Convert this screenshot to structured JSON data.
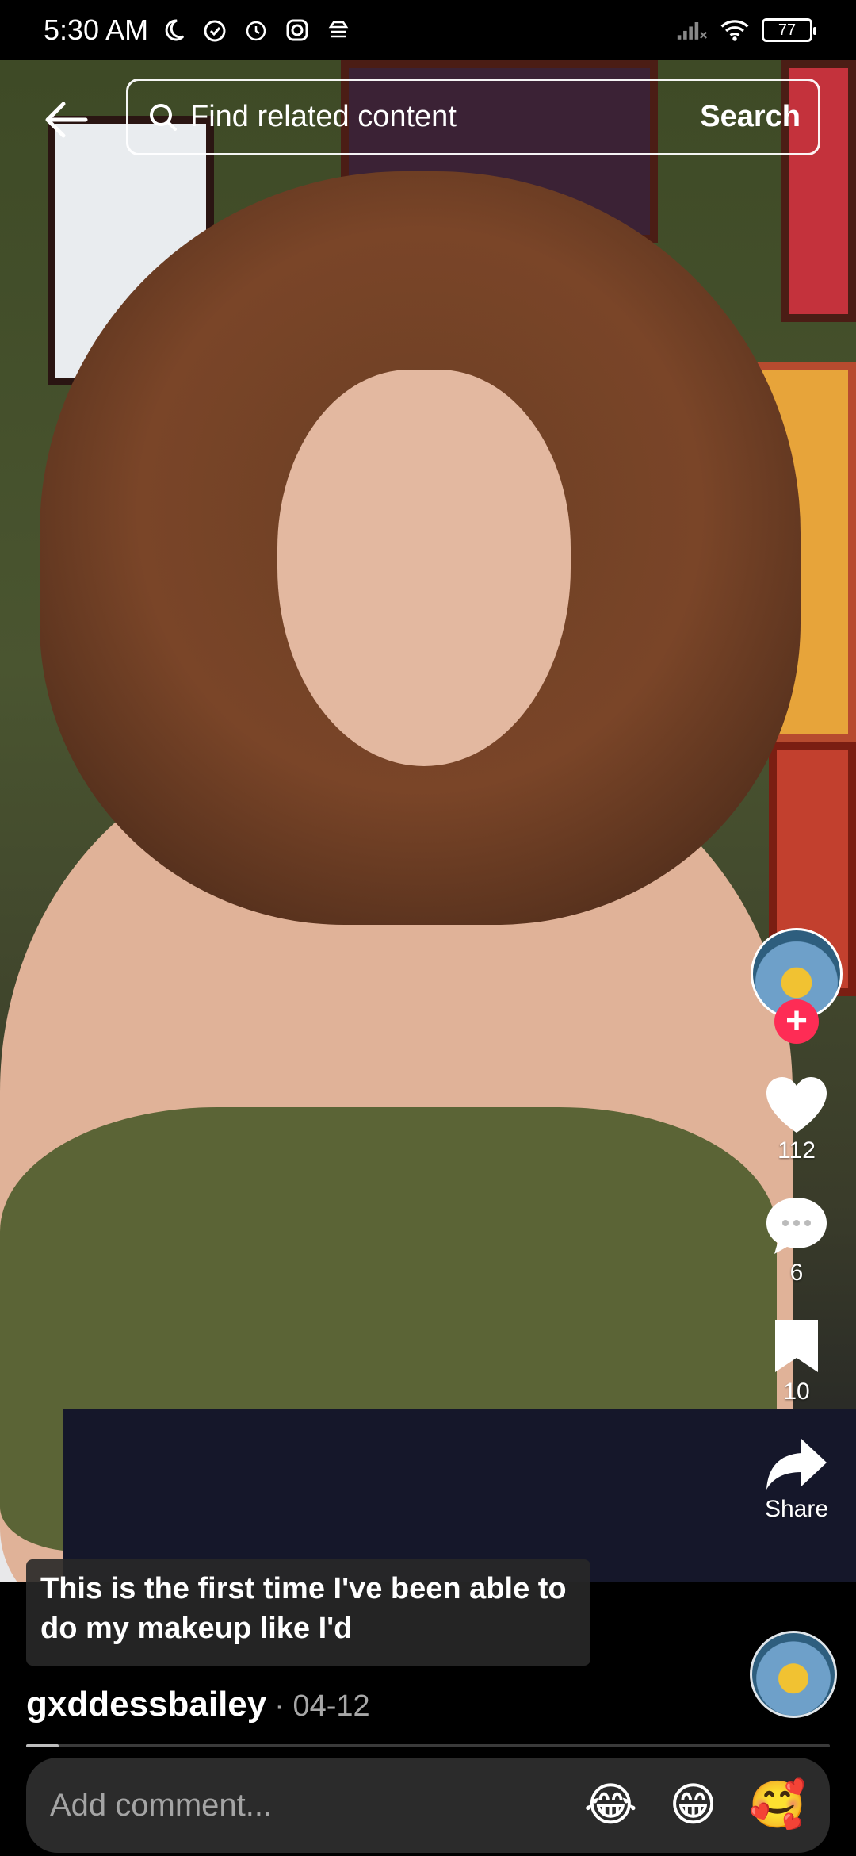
{
  "status_bar": {
    "time": "5:30 AM",
    "battery": "77",
    "icons": [
      "moon-icon",
      "alarm-icon",
      "alarm-clock-icon",
      "instagram-icon",
      "inbox-icon",
      "signal-icon",
      "wifi-icon",
      "battery-icon"
    ]
  },
  "search": {
    "placeholder": "Find related content",
    "button_label": "Search"
  },
  "actions": {
    "likes": "112",
    "comments": "6",
    "bookmarks": "10",
    "share_label": "Share"
  },
  "video": {
    "caption": "This is the first time I've been able to do my makeup like I'd",
    "author": "gxddessbailey",
    "date_separator": "·",
    "date": "04-12",
    "progress": 0.04
  },
  "comment_bar": {
    "placeholder": "Add comment...",
    "emojis": [
      "😂",
      "😁",
      "🥰"
    ]
  },
  "colors": {
    "follow_accent": "#fe2c55",
    "background": "#000000"
  }
}
